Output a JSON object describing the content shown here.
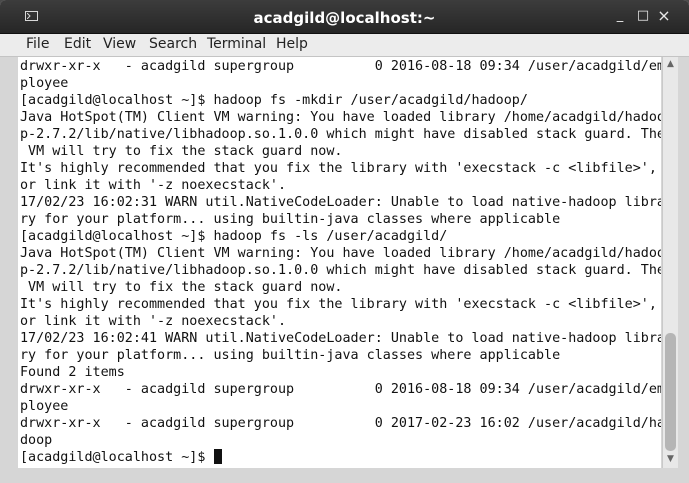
{
  "window": {
    "title": "acadgild@localhost:~",
    "controls": {
      "minimize": "_",
      "maximize": "□",
      "close": "×"
    }
  },
  "menu": [
    "File",
    "Edit",
    "View",
    "Search",
    "Terminal",
    "Help"
  ],
  "terminal": {
    "lines": [
      "drwxr-xr-x   - acadgild supergroup          0 2016-08-18 09:34 /user/acadgild/em",
      "ployee",
      "[acadgild@localhost ~]$ hadoop fs -mkdir /user/acadgild/hadoop/",
      "Java HotSpot(TM) Client VM warning: You have loaded library /home/acadgild/hadoo",
      "p-2.7.2/lib/native/libhadoop.so.1.0.0 which might have disabled stack guard. The",
      " VM will try to fix the stack guard now.",
      "It's highly recommended that you fix the library with 'execstack -c <libfile>',",
      "or link it with '-z noexecstack'.",
      "17/02/23 16:02:31 WARN util.NativeCodeLoader: Unable to load native-hadoop libra",
      "ry for your platform... using builtin-java classes where applicable",
      "[acadgild@localhost ~]$ hadoop fs -ls /user/acadgild/",
      "Java HotSpot(TM) Client VM warning: You have loaded library /home/acadgild/hadoo",
      "p-2.7.2/lib/native/libhadoop.so.1.0.0 which might have disabled stack guard. The",
      " VM will try to fix the stack guard now.",
      "It's highly recommended that you fix the library with 'execstack -c <libfile>',",
      "or link it with '-z noexecstack'.",
      "17/02/23 16:02:41 WARN util.NativeCodeLoader: Unable to load native-hadoop libra",
      "ry for your platform... using builtin-java classes where applicable",
      "Found 2 items",
      "drwxr-xr-x   - acadgild supergroup          0 2016-08-18 09:34 /user/acadgild/em",
      "ployee",
      "drwxr-xr-x   - acadgild supergroup          0 2017-02-23 16:02 /user/acadgild/ha",
      "doop"
    ],
    "prompt": "[acadgild@localhost ~]$ "
  },
  "scrollbar": {
    "up_arrow": "▲",
    "down_arrow": "▼"
  }
}
